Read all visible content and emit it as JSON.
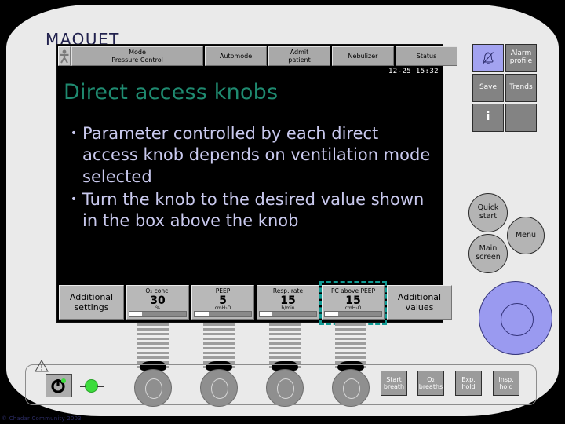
{
  "brand": {
    "logo": "MAQUET"
  },
  "display": {
    "toolbar": {
      "patient_icon": "patient-icon",
      "buttons": [
        {
          "name": "mode",
          "line1": "Mode",
          "line2": "Pressure Control"
        },
        {
          "name": "automode",
          "line1": "Automode",
          "line2": ""
        },
        {
          "name": "admit-patient",
          "line1": "Admit",
          "line2": "patient"
        },
        {
          "name": "nebulizer",
          "line1": "Nebulizer",
          "line2": ""
        },
        {
          "name": "status",
          "line1": "Status",
          "line2": ""
        }
      ]
    },
    "datetime": "12-25 15:32",
    "slide": {
      "title": "Direct access knobs",
      "bullet_marker": "•",
      "bullets": [
        "Parameter controlled by each direct access knob depends on ventilation mode selected",
        "Turn the knob to the desired value shown in the box above the knob"
      ],
      "title_color": "#1f8a70",
      "text_color": "#c9c9ee"
    },
    "parameter_bar": {
      "left_label_line1": "Additional",
      "left_label_line2": "settings",
      "right_label_line1": "Additional",
      "right_label_line2": "values",
      "selection_color": "#0f9b94",
      "parameters": [
        {
          "name": "O₂ conc.",
          "value": "30",
          "unit": "%",
          "fill_pct": 22,
          "selected": false
        },
        {
          "name": "PEEP",
          "value": "5",
          "unit": "cmH₂O",
          "fill_pct": 25,
          "selected": false
        },
        {
          "name": "Resp. rate",
          "value": "15",
          "unit": "b/min",
          "fill_pct": 22,
          "selected": false
        },
        {
          "name": "PC above PEEP",
          "value": "15",
          "unit": "cmH₂O",
          "fill_pct": 24,
          "selected": true
        }
      ]
    }
  },
  "side_keys": [
    {
      "name": "alarm-silence",
      "label": "",
      "icon": "bell-crossed-icon",
      "highlight": true
    },
    {
      "name": "alarm-profile",
      "label": "Alarm profile",
      "icon": "",
      "highlight": false
    },
    {
      "name": "save",
      "label": "Save",
      "icon": "",
      "highlight": false
    },
    {
      "name": "trends",
      "label": "Trends",
      "icon": "",
      "highlight": false
    },
    {
      "name": "info",
      "label": "i",
      "icon": "info-icon",
      "highlight": false
    },
    {
      "name": "blank",
      "label": "",
      "icon": "",
      "highlight": false
    }
  ],
  "round_buttons": [
    {
      "name": "quick-start",
      "line1": "Quick",
      "line2": "start"
    },
    {
      "name": "menu",
      "line1": "Menu",
      "line2": ""
    },
    {
      "name": "main-screen",
      "line1": "Main",
      "line2": "screen"
    }
  ],
  "rotary_dial": {
    "name": "main-rotary-dial",
    "color": "#9a9af0"
  },
  "lower_panel": {
    "warning_icon": "warning-triangle-icon",
    "power_button": "power-icon",
    "status_led": "green-status-led",
    "function_keys": [
      {
        "name": "start-breath",
        "line1": "Start",
        "line2": "breath"
      },
      {
        "name": "o2-breaths",
        "line1": "O₂",
        "line2": "breaths"
      },
      {
        "name": "exp-hold",
        "line1": "Exp.",
        "line2": "hold"
      },
      {
        "name": "insp-hold",
        "line1": "Insp.",
        "line2": "hold"
      }
    ]
  },
  "watermark": "© Chadar Community 2003"
}
